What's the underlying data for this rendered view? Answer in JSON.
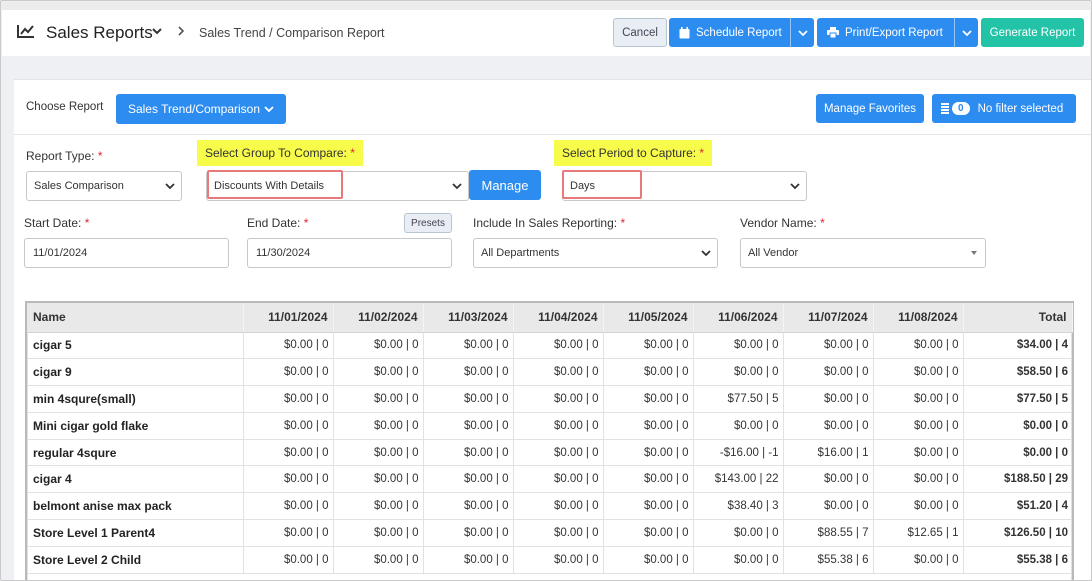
{
  "header": {
    "title": "Sales Reports",
    "breadcrumb": "Sales Trend / Comparison Report",
    "cancel": "Cancel",
    "schedule": "Schedule Report",
    "print": "Print/Export Report",
    "generate": "Generate Report"
  },
  "colors": {
    "primary": "#2d8cf0",
    "generate": "#22c3a7",
    "highlight": "#f7fb4a",
    "required": "#e0262b"
  },
  "choose": {
    "label": "Choose Report",
    "selected": "Sales Trend/Comparison",
    "manage_favorites": "Manage Favorites",
    "filter_count": "0",
    "filter_text": "No filter selected"
  },
  "form": {
    "report_type_label": "Report Type:",
    "report_type_value": "Sales Comparison",
    "group_label": "Select Group To Compare:",
    "group_value": "Discounts With Details",
    "manage": "Manage",
    "period_label": "Select Period to Capture:",
    "period_value": "Days",
    "start_label": "Start Date:",
    "start_value": "11/01/2024",
    "end_label": "End Date:",
    "end_value": "11/30/2024",
    "presets": "Presets",
    "include_label": "Include In Sales Reporting:",
    "include_value": "All Departments",
    "vendor_label": "Vendor Name:",
    "vendor_value": "All Vendor",
    "req": "*"
  },
  "table": {
    "columns": [
      "Name",
      "11/01/2024",
      "11/02/2024",
      "11/03/2024",
      "11/04/2024",
      "11/05/2024",
      "11/06/2024",
      "11/07/2024",
      "11/08/2024",
      "Total"
    ],
    "rows": [
      [
        "cigar 5",
        "$0.00 | 0",
        "$0.00 | 0",
        "$0.00 | 0",
        "$0.00 | 0",
        "$0.00 | 0",
        "$0.00 | 0",
        "$0.00 | 0",
        "$0.00 | 0",
        "$34.00 | 4"
      ],
      [
        "cigar 9",
        "$0.00 | 0",
        "$0.00 | 0",
        "$0.00 | 0",
        "$0.00 | 0",
        "$0.00 | 0",
        "$0.00 | 0",
        "$0.00 | 0",
        "$0.00 | 0",
        "$58.50 | 6"
      ],
      [
        "min 4squre(small)",
        "$0.00 | 0",
        "$0.00 | 0",
        "$0.00 | 0",
        "$0.00 | 0",
        "$0.00 | 0",
        "$77.50 | 5",
        "$0.00 | 0",
        "$0.00 | 0",
        "$77.50 | 5"
      ],
      [
        "Mini cigar gold flake",
        "$0.00 | 0",
        "$0.00 | 0",
        "$0.00 | 0",
        "$0.00 | 0",
        "$0.00 | 0",
        "$0.00 | 0",
        "$0.00 | 0",
        "$0.00 | 0",
        "$0.00 | 0"
      ],
      [
        "regular 4squre",
        "$0.00 | 0",
        "$0.00 | 0",
        "$0.00 | 0",
        "$0.00 | 0",
        "$0.00 | 0",
        "-$16.00 | -1",
        "$16.00 | 1",
        "$0.00 | 0",
        "$0.00 | 0"
      ],
      [
        "cigar 4",
        "$0.00 | 0",
        "$0.00 | 0",
        "$0.00 | 0",
        "$0.00 | 0",
        "$0.00 | 0",
        "$143.00 | 22",
        "$0.00 | 0",
        "$0.00 | 0",
        "$188.50 | 29"
      ],
      [
        "belmont anise max pack",
        "$0.00 | 0",
        "$0.00 | 0",
        "$0.00 | 0",
        "$0.00 | 0",
        "$0.00 | 0",
        "$38.40 | 3",
        "$0.00 | 0",
        "$0.00 | 0",
        "$51.20 | 4"
      ],
      [
        "Store Level 1 Parent4",
        "$0.00 | 0",
        "$0.00 | 0",
        "$0.00 | 0",
        "$0.00 | 0",
        "$0.00 | 0",
        "$0.00 | 0",
        "$88.55 | 7",
        "$12.65 | 1",
        "$126.50 | 10"
      ],
      [
        "Store Level 2 Child",
        "$0.00 | 0",
        "$0.00 | 0",
        "$0.00 | 0",
        "$0.00 | 0",
        "$0.00 | 0",
        "$0.00 | 0",
        "$55.38 | 6",
        "$0.00 | 0",
        "$55.38 | 6"
      ]
    ]
  }
}
